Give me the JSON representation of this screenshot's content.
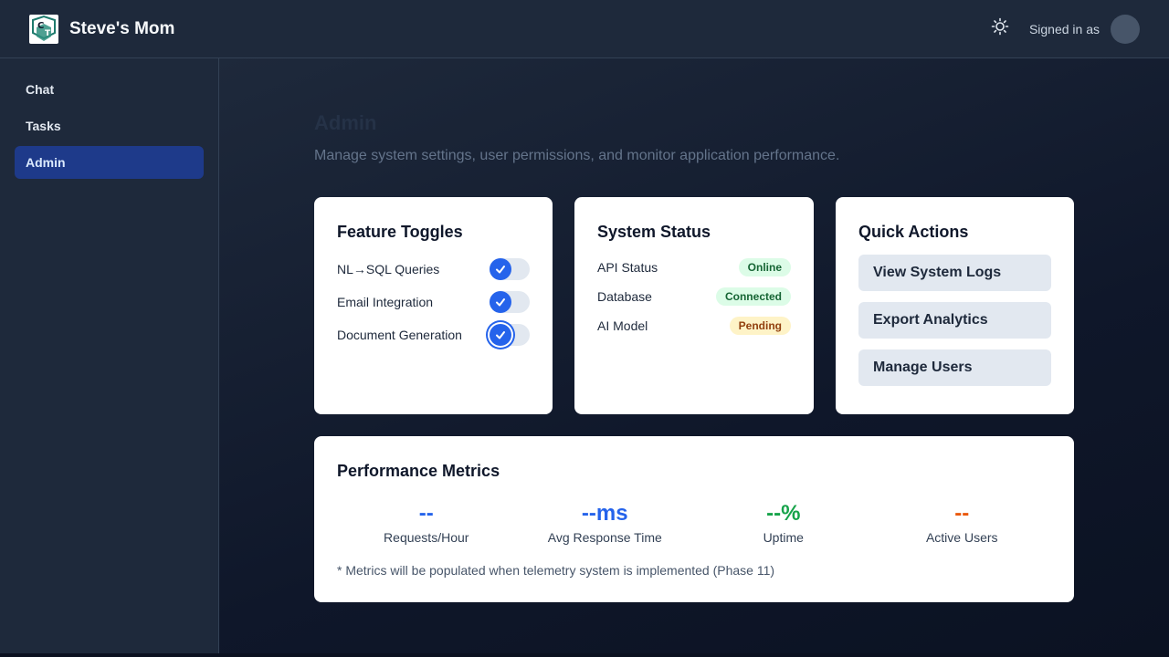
{
  "header": {
    "title": "Steve's Mom",
    "logo_icon": "app-logo",
    "theme_icon": "sun-icon",
    "signed_in_label": "Signed in as"
  },
  "sidebar": {
    "items": [
      {
        "label": "Chat",
        "active": false
      },
      {
        "label": "Tasks",
        "active": false
      },
      {
        "label": "Admin",
        "active": true
      }
    ]
  },
  "main": {
    "title": "Admin",
    "subtitle": "Manage system settings, user permissions, and monitor application performance."
  },
  "features": {
    "title": "Feature Toggles",
    "toggles": [
      {
        "label": "NL→SQL Queries",
        "enabled": true
      },
      {
        "label": "Email Integration",
        "enabled": true
      },
      {
        "label": "Document Generation",
        "enabled": true
      }
    ]
  },
  "status": {
    "title": "System Status",
    "rows": [
      {
        "label": "API Status",
        "value": "Online",
        "color": "green"
      },
      {
        "label": "Database",
        "value": "Connected",
        "color": "green"
      },
      {
        "label": "AI Model",
        "value": "Pending",
        "color": "yellow"
      }
    ]
  },
  "actions": {
    "title": "Quick Actions",
    "buttons": [
      "View System Logs",
      "Export Analytics",
      "Manage Users"
    ]
  },
  "metrics": {
    "title": "Performance Metrics",
    "items": [
      {
        "value": "--",
        "label": "Requests/Hour",
        "color": "#2563eb"
      },
      {
        "value": "--ms",
        "label": "Avg Response Time",
        "color": "#2563eb"
      },
      {
        "value": "--%",
        "label": "Uptime",
        "color": "#16a34a"
      },
      {
        "value": "--",
        "label": "Active Users",
        "color": "#ea580c"
      }
    ],
    "note": "* Metrics will be populated when telemetry system is implemented (Phase 11)"
  }
}
